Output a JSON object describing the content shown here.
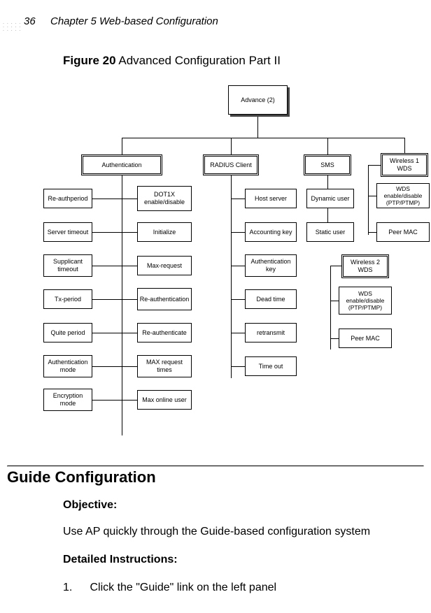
{
  "page_number": "36",
  "chapter_header": "Chapter 5 Web-based Configuration",
  "figure_label": "Figure 20",
  "figure_title": "Advanced Configuration Part II",
  "diagram": {
    "root": "Advance (2)",
    "authentication": {
      "title": "Authentication",
      "left": [
        "Re-authperiod",
        "Server timeout",
        "Supplicant timeout",
        "Tx-period",
        "Quite period",
        "Authentication mode",
        "Encryption mode"
      ],
      "right": [
        "DOT1X enable/disable",
        "Initialize",
        "Max-request",
        "Re-authentication",
        "Re-authenticate",
        "MAX request times",
        "Max online user"
      ]
    },
    "radius": {
      "title": "RADIUS Client",
      "items": [
        "Host server",
        "Accounting key",
        "Authentication key",
        "Dead time",
        "retransmit",
        "Time out"
      ]
    },
    "sms": {
      "title": "SMS",
      "items": [
        "Dynamic user",
        "Static user"
      ]
    },
    "wds1": {
      "title": "Wireless 1 WDS",
      "items": [
        "WDS enable/disable (PTP/PTMP)",
        "Peer MAC"
      ]
    },
    "wds2": {
      "title": "Wireless 2 WDS",
      "items": [
        "WDS enable/disable (PTP/PTMP)",
        "Peer MAC"
      ]
    }
  },
  "section_title": "Guide Configuration",
  "objective_heading": "Objective:",
  "objective_text": "Use AP quickly through the Guide-based configuration system",
  "instructions_heading": "Detailed Instructions:",
  "step1_num": "1.",
  "step1_text": "Click the \"Guide\" link on the left panel"
}
